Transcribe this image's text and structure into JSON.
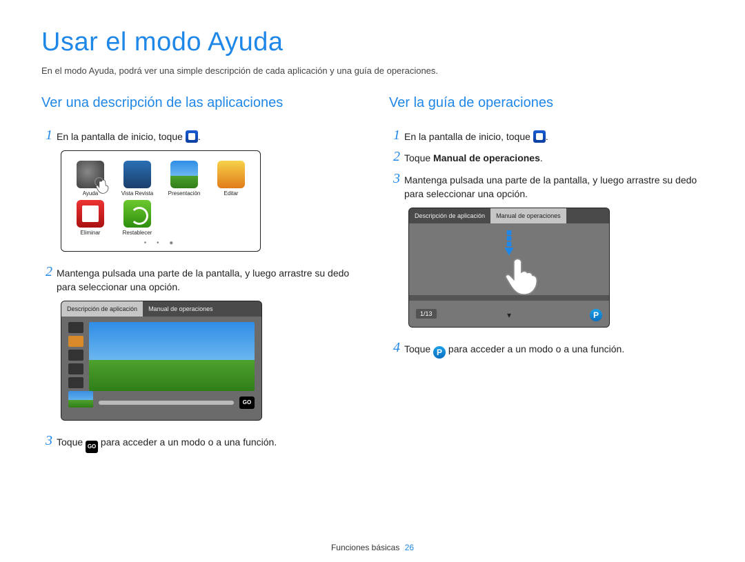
{
  "title": "Usar el modo Ayuda",
  "intro": "En el modo Ayuda, podrá ver una simple descripción de cada aplicación y una guía de operaciones.",
  "footer": {
    "section": "Funciones básicas",
    "page": "26"
  },
  "tabs": {
    "desc": "Descripción de aplicación",
    "manual": "Manual de operaciones"
  },
  "left": {
    "heading": "Ver una descripción de las aplicaciones",
    "step1": {
      "pre": "En la pantalla de inicio, toque ",
      "post": "."
    },
    "apps": [
      {
        "label": "Ayuda"
      },
      {
        "label": "Vista Revista"
      },
      {
        "label": "Presentación"
      },
      {
        "label": "Editar"
      },
      {
        "label": "Eliminar"
      },
      {
        "label": "Restablecer"
      }
    ],
    "step2": "Mantenga pulsada una parte de la pantalla, y luego arrastre su dedo para seleccionar una opción.",
    "step3": {
      "pre": "Toque ",
      "post": " para acceder a un modo o a una función."
    },
    "go_label": "GO"
  },
  "right": {
    "heading": "Ver la guía de operaciones",
    "step1": {
      "pre": "En la pantalla de inicio, toque ",
      "post": "."
    },
    "step2": {
      "pre": "Toque ",
      "bold": "Manual de operaciones",
      "post": "."
    },
    "step3": "Mantenga pulsada una parte de la pantalla, y luego arrastre su dedo para seleccionar una opción.",
    "page_indicator": "1/13",
    "p_label": "P",
    "step4": {
      "pre": "Toque ",
      "post": " para acceder a un modo o a una función."
    }
  }
}
